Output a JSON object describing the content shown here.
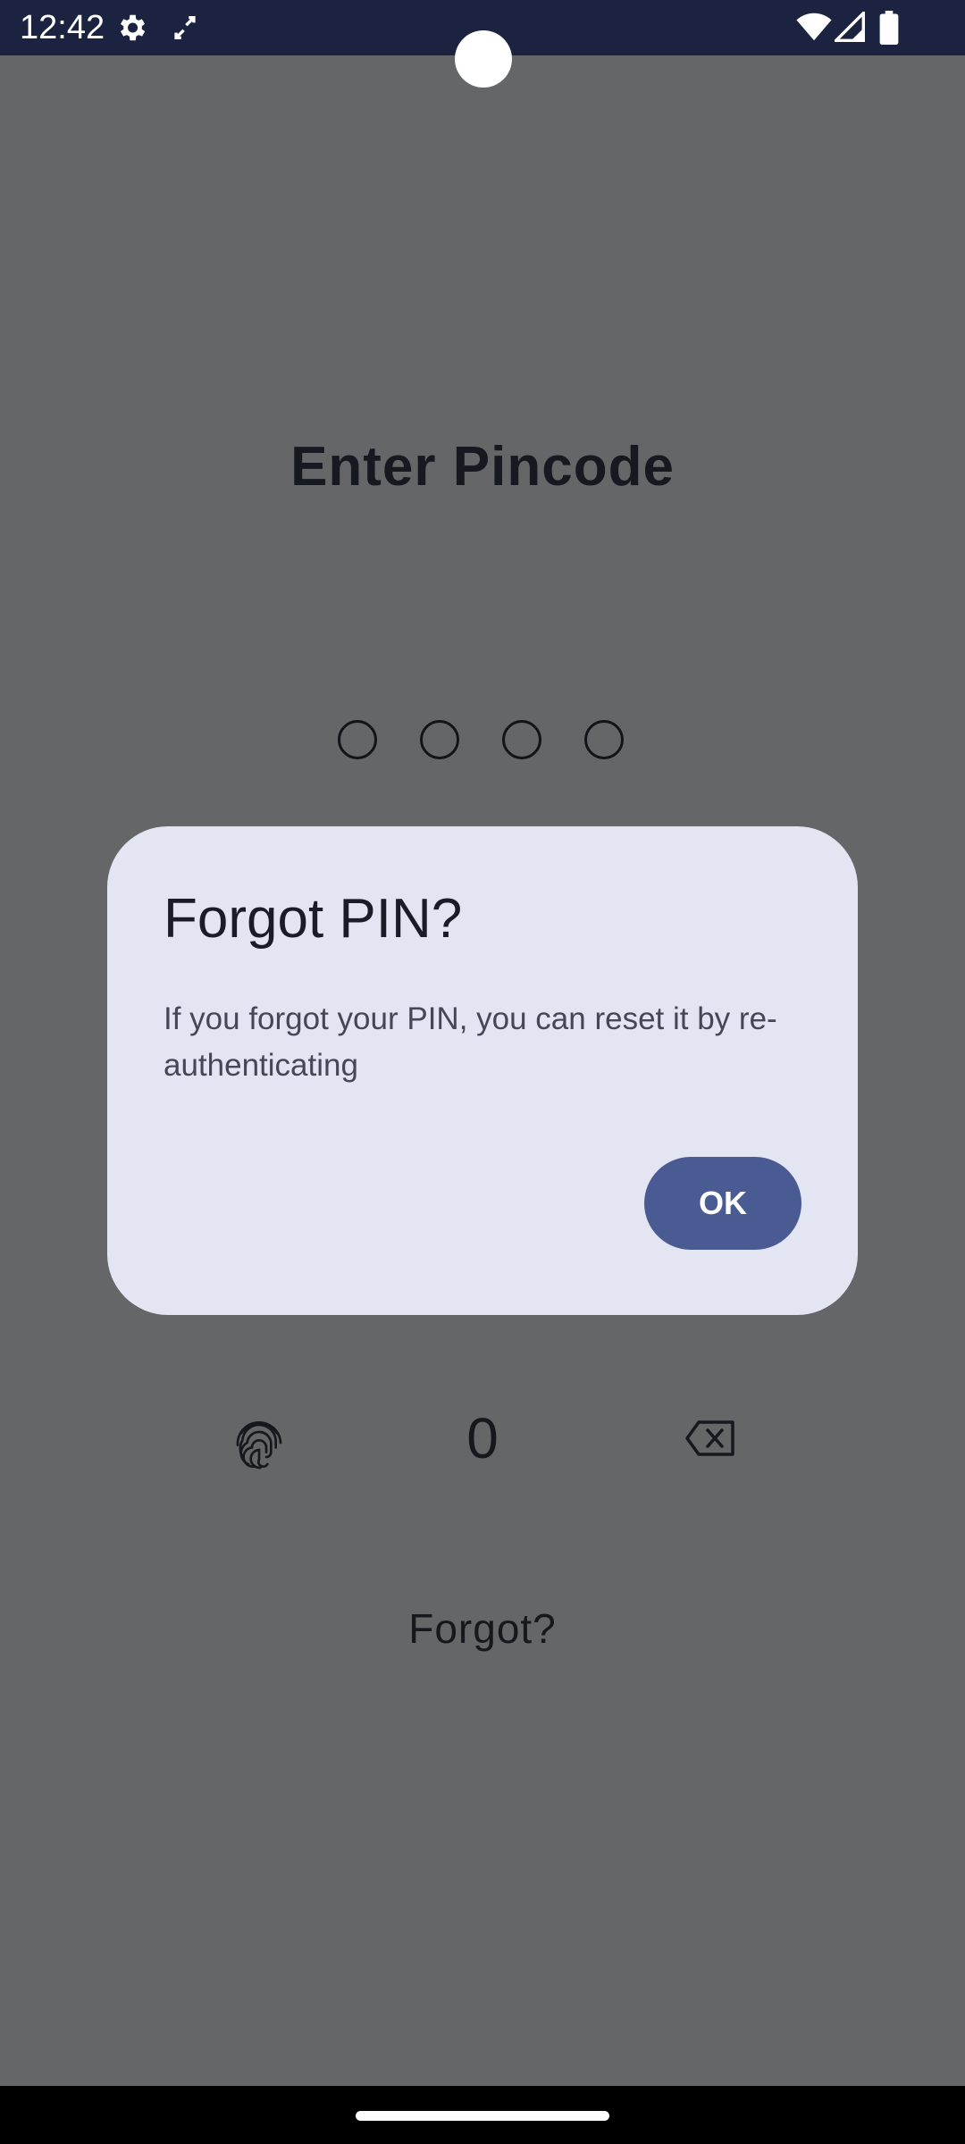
{
  "status_bar": {
    "time": "12:42",
    "left_icons": [
      "settings-icon",
      "screen-rotate-icon"
    ],
    "right_icons": [
      "wifi-icon",
      "cell-signal-icon",
      "battery-icon"
    ]
  },
  "lock_screen": {
    "title": "Enter Pincode",
    "pin_length": 4,
    "pin_filled": 0,
    "keypad": {
      "fingerprint_icon": "fingerprint-icon",
      "zero_label": "0",
      "backspace_icon": "backspace-icon"
    },
    "forgot_label": "Forgot?"
  },
  "dialog": {
    "title": "Forgot PIN?",
    "message": "If you forgot your PIN, you can reset it by re-authenticating",
    "ok_label": "OK",
    "ok_color": "#4a5b94"
  },
  "colors": {
    "scrim_background": "#656668",
    "status_bar": "#1b2340",
    "dialog_background": "#e3e5f2"
  }
}
